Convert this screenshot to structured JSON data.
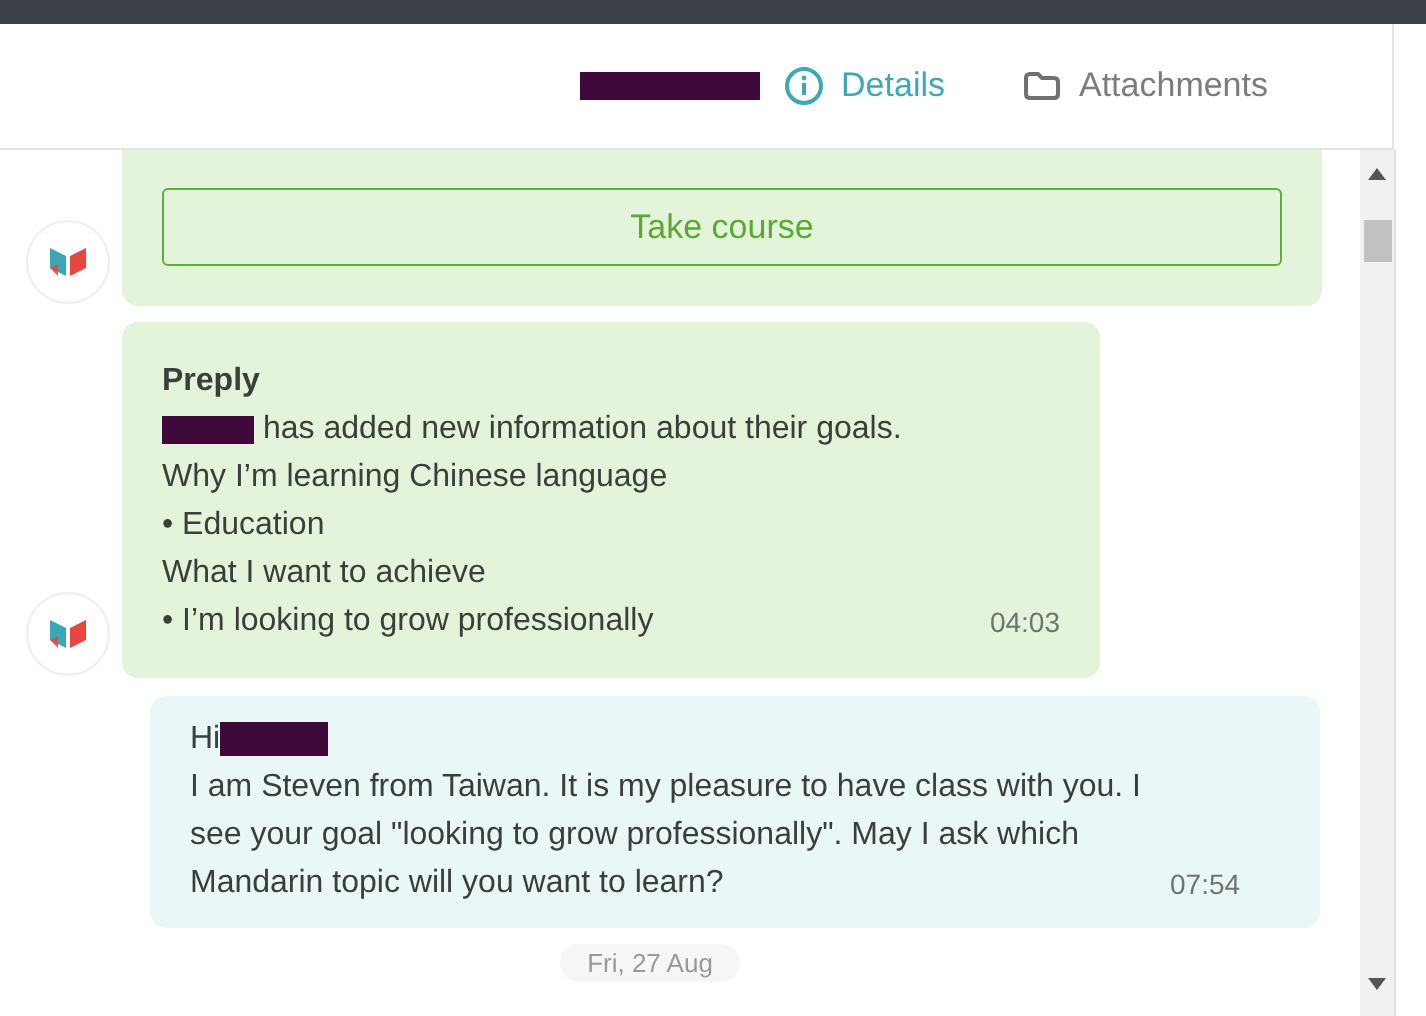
{
  "header": {
    "redacted": true,
    "tabs": [
      {
        "label": "Details",
        "selected": true,
        "kind": "info"
      },
      {
        "label": "Attachments",
        "selected": false,
        "kind": "attachment"
      }
    ]
  },
  "messages": [
    {
      "kind": "course",
      "button": "Take course"
    },
    {
      "kind": "notice",
      "sender": "Preply",
      "lines": [
        {
          "text": "has added new information about their goals.",
          "redacted": true
        },
        {
          "text": "Why I’m learning Chinese language",
          "redacted": false
        },
        {
          "text": "• Education",
          "redacted": false
        },
        {
          "text": "What I want to achieve",
          "redacted": false
        },
        {
          "text": "• I’m looking to grow professionally",
          "redacted": false
        }
      ],
      "time": "04:03"
    },
    {
      "kind": "outgoing",
      "greeting": "Hi",
      "redacted": true,
      "text": "I am Steven from Taiwan. It is my pleasure to have class with you. I see your goal \"looking to grow professionally\". May I ask which Mandarin topic will you want to learn?",
      "time": "07:54"
    }
  ],
  "date_divider": "Fri, 27 Aug"
}
